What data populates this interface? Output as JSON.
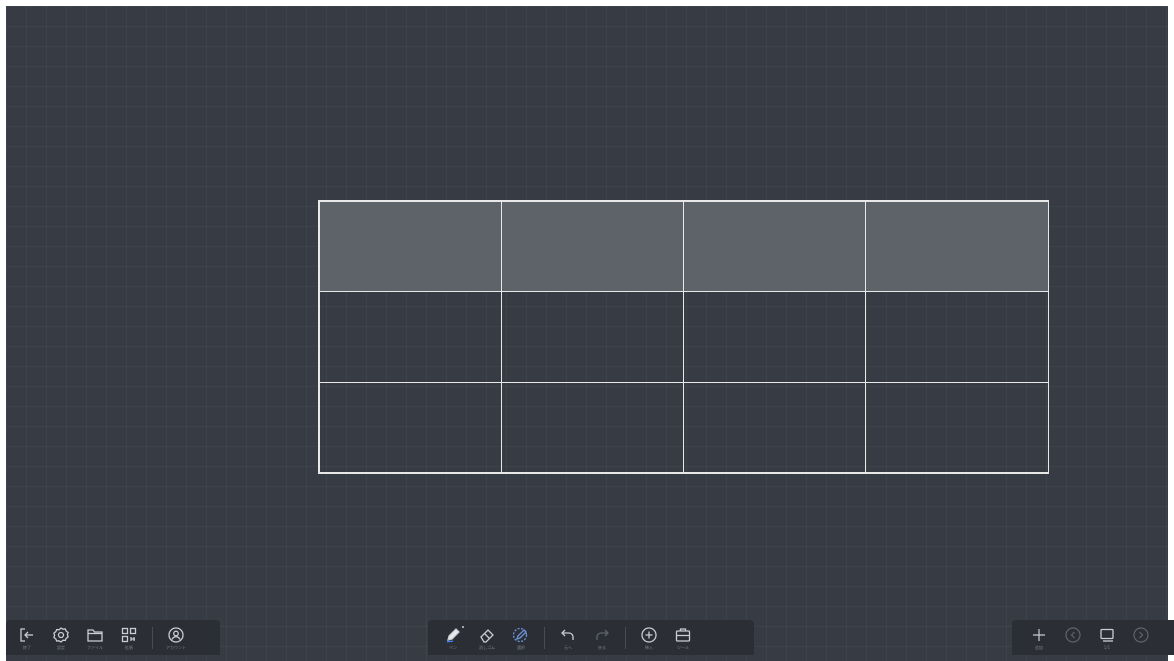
{
  "table": {
    "columns": 4,
    "rows": 3,
    "header_row_fill": "#5d6369",
    "border_color": "#e8e8e8"
  },
  "left_toolbar": {
    "items": [
      {
        "icon": "exit-icon",
        "label": "終了"
      },
      {
        "icon": "settings-icon",
        "label": "設定"
      },
      {
        "icon": "folder-icon",
        "label": "ファイル"
      },
      {
        "icon": "apps-icon",
        "label": "拡張"
      },
      {
        "icon": "account-icon",
        "label": "アカウント"
      }
    ]
  },
  "center_toolbar": {
    "items": [
      {
        "icon": "pen-icon",
        "label": "ペン"
      },
      {
        "icon": "eraser-icon",
        "label": "消しゴム"
      },
      {
        "icon": "lasso-icon",
        "label": "選択"
      },
      {
        "icon": "undo-icon",
        "label": "元へ"
      },
      {
        "icon": "redo-icon",
        "label": "戻る"
      },
      {
        "icon": "insert-icon",
        "label": "挿入"
      },
      {
        "icon": "toolbox-icon",
        "label": "ツール"
      }
    ]
  },
  "right_toolbar": {
    "items": [
      {
        "icon": "plus-icon",
        "label": "追加"
      },
      {
        "icon": "previous-page-icon",
        "label": ""
      },
      {
        "icon": "pages-icon",
        "label": "1/1"
      },
      {
        "icon": "next-page-icon",
        "label": ""
      }
    ]
  },
  "colors": {
    "canvas": "#373b43",
    "toolbar": "#2b2f35",
    "icon": "#c9ccd1",
    "accent": "#3b82f6"
  }
}
